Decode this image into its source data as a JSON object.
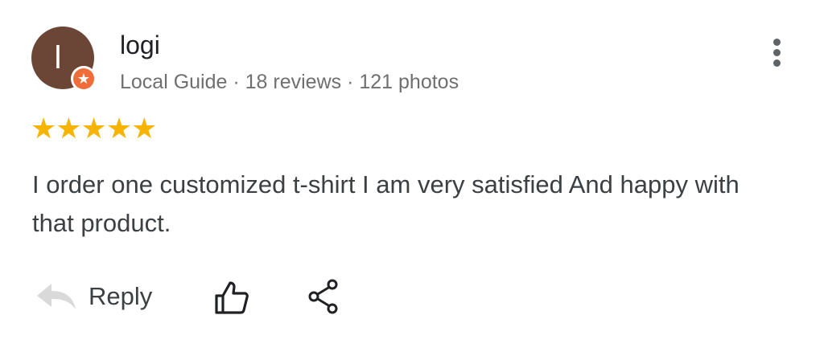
{
  "review": {
    "author": {
      "initial": "l",
      "name": "logi",
      "meta": "Local Guide · 18 reviews · 121 photos",
      "avatar_color": "#6b4636",
      "badge_color": "#ef6c3b",
      "badge_icon": "local-guide-star-icon"
    },
    "rating": {
      "value": 5,
      "max": 5,
      "stars_text": "★★★★★",
      "color": "#f6b400"
    },
    "text": "I order one customized t-shirt I am very satisfied And happy with that product.",
    "actions": {
      "reply_label": "Reply",
      "reply_icon": "reply-arrow-icon",
      "like_icon": "thumbs-up-icon",
      "share_icon": "share-icon"
    },
    "more_icon": "more-vert-icon"
  }
}
